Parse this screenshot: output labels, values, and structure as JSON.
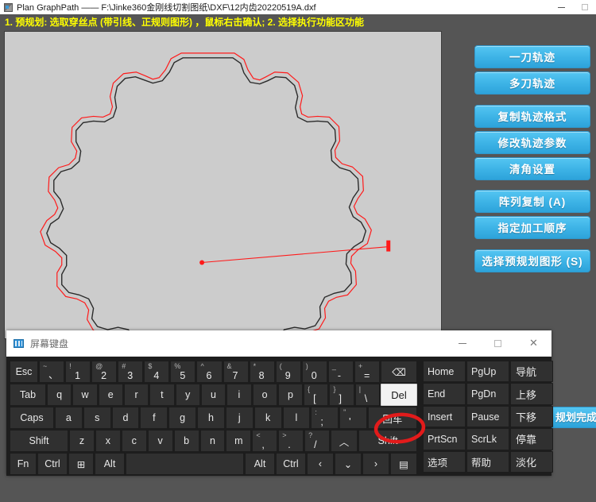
{
  "window": {
    "title": "Plan GraphPath —— F:\\Jinke360金刚线切割图纸\\DXF\\12内齿20220519A.dxf",
    "icon": "app-icon",
    "minimize_label": "—",
    "maximize_label": "□"
  },
  "hint_bar": {
    "text": "1. 预规划: 选取穿丝点 (带引线、正规则图形) ，鼠标右击确认;  2. 选择执行功能区功能",
    "color": "#ffff00",
    "background": "#555555"
  },
  "canvas": {
    "background": "#cccccc",
    "shape_name": "gear-outline",
    "contour_color": "#2b2b2b",
    "toolpath_color": "#ff0000",
    "lead_in_label": "lead-in-line",
    "pierce_point_label": "pierce-point"
  },
  "toolbar": {
    "buttons": [
      {
        "label": "一刀轨迹",
        "name": "single-pass-path-button"
      },
      {
        "label": "多刀轨迹",
        "name": "multi-pass-path-button"
      },
      {
        "label": "复制轨迹格式",
        "name": "copy-path-format-button"
      },
      {
        "label": "修改轨迹参数",
        "name": "edit-path-params-button"
      },
      {
        "label": "清角设置",
        "name": "corner-clear-settings-button"
      },
      {
        "label": "阵列复制 (A)",
        "name": "array-copy-button"
      },
      {
        "label": "指定加工顺序",
        "name": "set-machining-order-button"
      },
      {
        "label": "选择预规划图形 (S)",
        "name": "select-preplanned-shape-button"
      }
    ],
    "accent": "#3db3e6",
    "finish_button": "规划完成"
  },
  "osk": {
    "title": "屏幕键盘",
    "minimize_label": "—",
    "maximize_label": "□",
    "close_label": "✕",
    "highlighted_key": "Del",
    "rows": [
      {
        "name": "number-row",
        "keys": [
          {
            "label": "Esc",
            "type": "wide-esc"
          },
          {
            "up": "~",
            "lo": "、"
          },
          {
            "up": "!",
            "lo": "1"
          },
          {
            "up": "@",
            "lo": "2"
          },
          {
            "up": "#",
            "lo": "3"
          },
          {
            "up": "$",
            "lo": "4"
          },
          {
            "up": "%",
            "lo": "5"
          },
          {
            "up": "^",
            "lo": "6"
          },
          {
            "up": "&",
            "lo": "7"
          },
          {
            "up": "*",
            "lo": "8"
          },
          {
            "up": "(",
            "lo": "9"
          },
          {
            "up": ")",
            "lo": "0"
          },
          {
            "up": "_",
            "lo": "-"
          },
          {
            "up": "+",
            "lo": "="
          },
          {
            "label": "⌫",
            "type": "wide-back"
          }
        ]
      },
      {
        "name": "qwerty-row",
        "keys": [
          {
            "label": "Tab",
            "type": "wide-tab"
          },
          {
            "label": "q"
          },
          {
            "label": "w"
          },
          {
            "label": "e"
          },
          {
            "label": "r"
          },
          {
            "label": "t"
          },
          {
            "label": "y"
          },
          {
            "label": "u"
          },
          {
            "label": "i"
          },
          {
            "label": "o"
          },
          {
            "label": "p"
          },
          {
            "up": "{",
            "lo": "["
          },
          {
            "up": "}",
            "lo": "]"
          },
          {
            "up": "|",
            "lo": "\\"
          },
          {
            "label": "Del",
            "type": "del"
          }
        ]
      },
      {
        "name": "home-row",
        "keys": [
          {
            "label": "Caps",
            "type": "wide-caps"
          },
          {
            "label": "a"
          },
          {
            "label": "s"
          },
          {
            "label": "d"
          },
          {
            "label": "f"
          },
          {
            "label": "g"
          },
          {
            "label": "h"
          },
          {
            "label": "j"
          },
          {
            "label": "k"
          },
          {
            "label": "l"
          },
          {
            "up": ":",
            "lo": ";"
          },
          {
            "up": "\"",
            "lo": "'"
          },
          {
            "label": "回车",
            "type": "wide-enter"
          }
        ]
      },
      {
        "name": "shift-row",
        "keys": [
          {
            "label": "Shift",
            "type": "wide-shift"
          },
          {
            "label": "z"
          },
          {
            "label": "x"
          },
          {
            "label": "c"
          },
          {
            "label": "v"
          },
          {
            "label": "b"
          },
          {
            "label": "n"
          },
          {
            "label": "m"
          },
          {
            "up": "<",
            "lo": ","
          },
          {
            "up": ">",
            "lo": "."
          },
          {
            "up": "?",
            "lo": "/"
          },
          {
            "label": "︿",
            "type": "small"
          },
          {
            "label": "Shift",
            "type": "wide-shift"
          }
        ]
      },
      {
        "name": "modifier-row",
        "keys": [
          {
            "label": "Fn",
            "type": "wide-fn"
          },
          {
            "label": "Ctrl",
            "type": "wide-ctrl"
          },
          {
            "label": "⊞",
            "type": "wide-win"
          },
          {
            "label": "Alt",
            "type": "wide-alt"
          },
          {
            "label": "",
            "type": "space"
          },
          {
            "label": "Alt",
            "type": "wide-alt"
          },
          {
            "label": "Ctrl",
            "type": "wide-ctrl"
          },
          {
            "label": "‹",
            "type": "small"
          },
          {
            "label": "⌄",
            "type": "small"
          },
          {
            "label": "›",
            "type": "small"
          },
          {
            "label": "▤",
            "type": "small"
          }
        ]
      }
    ],
    "nav_columns": [
      {
        "name": "nav-col-1",
        "keys": [
          "Home",
          "End",
          "Insert",
          "PrtScn",
          "选项"
        ]
      },
      {
        "name": "nav-col-2",
        "keys": [
          "PgUp",
          "PgDn",
          "Pause",
          "ScrLk",
          "帮助"
        ]
      },
      {
        "name": "nav-col-3",
        "keys": [
          "导航",
          "上移",
          "下移",
          "停靠",
          "淡化"
        ]
      }
    ]
  }
}
